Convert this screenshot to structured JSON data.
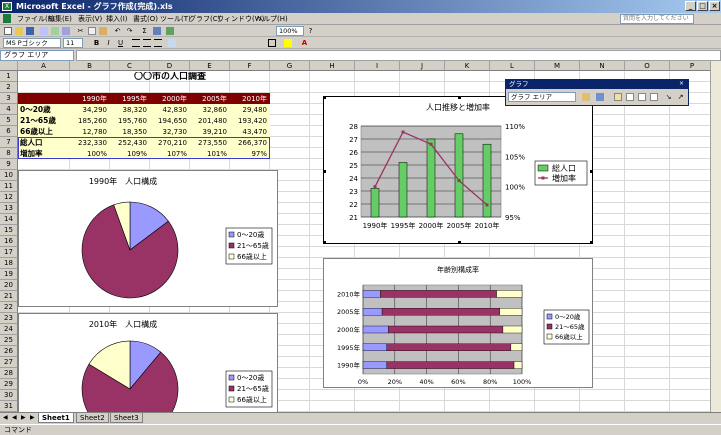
{
  "window": {
    "title": "Microsoft Excel - グラフ作成(完成).xls",
    "app_icon": "X"
  },
  "menus": [
    "ファイル(F)",
    "編集(E)",
    "表示(V)",
    "挿入(I)",
    "書式(O)",
    "ツール(T)",
    "グラフ(C)",
    "ウィンドウ(W)",
    "ヘルプ(H)"
  ],
  "help_placeholder": "質問を入力してください",
  "toolbar": {
    "font_name": "MS Pゴシック",
    "font_size": "11",
    "bold": "B",
    "italic": "I",
    "underline": "U",
    "zoom": "100%"
  },
  "namebox": "グラフ エリア",
  "columns": [
    "A",
    "B",
    "C",
    "D",
    "E",
    "F",
    "G",
    "H",
    "I",
    "J",
    "K",
    "L",
    "M",
    "N",
    "O",
    "P"
  ],
  "rows": [
    "1",
    "2",
    "3",
    "4",
    "5",
    "6",
    "7",
    "8",
    "9",
    "10",
    "11",
    "12",
    "13",
    "14",
    "15",
    "16",
    "17",
    "18",
    "19",
    "20",
    "21",
    "22",
    "23",
    "24",
    "25",
    "26",
    "27",
    "28",
    "29",
    "30",
    "31",
    "32"
  ],
  "table": {
    "title": "〇〇市の人口調査",
    "headers": [
      "1990年",
      "1995年",
      "2000年",
      "2005年",
      "2010年"
    ],
    "rows": [
      {
        "label": "0〜20歳",
        "values": [
          "34,290",
          "38,320",
          "42,830",
          "32,860",
          "29,480"
        ]
      },
      {
        "label": "21〜65歳",
        "values": [
          "185,260",
          "195,760",
          "194,650",
          "201,480",
          "193,420"
        ]
      },
      {
        "label": "66歳以上",
        "values": [
          "12,780",
          "18,350",
          "32,730",
          "39,210",
          "43,470"
        ]
      },
      {
        "label": "総人口",
        "values": [
          "232,330",
          "252,430",
          "270,210",
          "273,550",
          "266,370"
        ]
      },
      {
        "label": "増加率",
        "values": [
          "100%",
          "109%",
          "107%",
          "101%",
          "97%"
        ]
      }
    ]
  },
  "chart_data": [
    {
      "type": "pie",
      "title": "1990年　人口構成",
      "categories": [
        "0〜20歳",
        "21〜65歳",
        "66歳以上"
      ],
      "values": [
        34290,
        185260,
        12780
      ],
      "colors": [
        "#9999ff",
        "#993366",
        "#ffffcc"
      ],
      "legend": "right"
    },
    {
      "type": "pie",
      "title": "2010年　人口構成",
      "categories": [
        "0〜20歳",
        "21〜65歳",
        "66歳以上"
      ],
      "values": [
        29480,
        193420,
        43470
      ],
      "colors": [
        "#9999ff",
        "#993366",
        "#ffffcc"
      ],
      "legend": "right"
    },
    {
      "type": "bar",
      "title": "人口推移と増加率",
      "categories": [
        "1990年",
        "1995年",
        "2000年",
        "2005年",
        "2010年"
      ],
      "series": [
        {
          "name": "総人口",
          "values": [
            23.2,
            25.2,
            27.0,
            27.4,
            26.6
          ],
          "color": "#66cc66"
        },
        {
          "name": "増加率",
          "values": [
            100,
            109,
            107,
            101,
            97
          ],
          "color": "#993366"
        }
      ],
      "y_ticks": [
        "21",
        "22",
        "23",
        "24",
        "25",
        "26",
        "27",
        "28"
      ],
      "ylim": [
        21,
        28
      ],
      "y2_ticks": [
        "95%",
        "100%",
        "105%",
        "110%"
      ],
      "y2lim": [
        95,
        110
      ],
      "legend": "right"
    },
    {
      "type": "bar",
      "title": "年齢別構成率",
      "categories": [
        "2010年",
        "2005年",
        "2000年",
        "1995年",
        "1990年"
      ],
      "series": [
        {
          "name": "0〜20歳",
          "values": [
            11,
            12,
            16,
            15,
            15
          ],
          "color": "#9999ff"
        },
        {
          "name": "21〜65歳",
          "values": [
            73,
            74,
            72,
            78,
            80
          ],
          "color": "#993366"
        },
        {
          "name": "66歳以上",
          "values": [
            16,
            14,
            12,
            7,
            5
          ],
          "color": "#ffffcc"
        }
      ],
      "x_ticks": [
        "0%",
        "20%",
        "40%",
        "60%",
        "80%",
        "100%"
      ],
      "xlim": [
        0,
        100
      ],
      "legend": "right"
    }
  ],
  "chart_toolbar": {
    "title": "グラフ",
    "area_select": "グラフ エリア"
  },
  "sheets": [
    "Sheet1",
    "Sheet2",
    "Sheet3"
  ],
  "status": "コマンド"
}
